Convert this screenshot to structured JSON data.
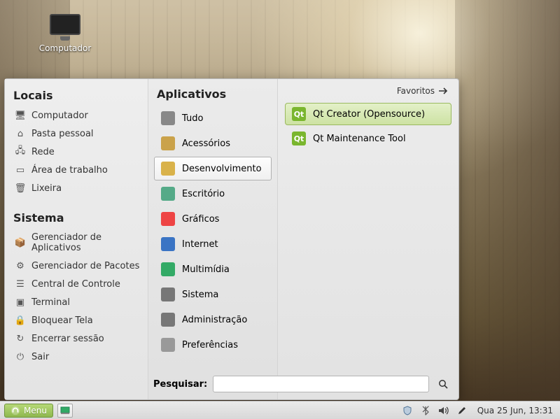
{
  "desktop": {
    "icon_label": "Computador"
  },
  "menu": {
    "places_heading": "Locais",
    "places": [
      {
        "label": "Computador",
        "icon": "monitor-icon"
      },
      {
        "label": "Pasta pessoal",
        "icon": "home-icon"
      },
      {
        "label": "Rede",
        "icon": "network-icon"
      },
      {
        "label": "Área de trabalho",
        "icon": "desktop-icon"
      },
      {
        "label": "Lixeira",
        "icon": "trash-icon"
      }
    ],
    "system_heading": "Sistema",
    "system": [
      {
        "label": "Gerenciador de Aplicativos",
        "icon": "apps-mgr-icon"
      },
      {
        "label": "Gerenciador de Pacotes",
        "icon": "pkg-mgr-icon"
      },
      {
        "label": "Central de Controle",
        "icon": "control-center-icon"
      },
      {
        "label": "Terminal",
        "icon": "terminal-icon"
      },
      {
        "label": "Bloquear Tela",
        "icon": "lock-icon"
      },
      {
        "label": "Encerrar sessão",
        "icon": "logout-icon"
      },
      {
        "label": "Sair",
        "icon": "power-icon"
      }
    ],
    "apps_heading": "Aplicativos",
    "favorites_label": "Favoritos",
    "categories": [
      {
        "label": "Tudo",
        "icon": "all-icon",
        "color": "#888"
      },
      {
        "label": "Acessórios",
        "icon": "accessories-icon",
        "color": "#caa24a"
      },
      {
        "label": "Desenvolvimento",
        "icon": "development-icon",
        "color": "#d9b24a",
        "selected": true
      },
      {
        "label": "Escritório",
        "icon": "office-icon",
        "color": "#5a8"
      },
      {
        "label": "Gráficos",
        "icon": "graphics-icon",
        "color": "#e44"
      },
      {
        "label": "Internet",
        "icon": "internet-icon",
        "color": "#3a74c4"
      },
      {
        "label": "Multimídia",
        "icon": "multimedia-icon",
        "color": "#3a6"
      },
      {
        "label": "Sistema",
        "icon": "system-icon",
        "color": "#777"
      },
      {
        "label": "Administração",
        "icon": "admin-icon",
        "color": "#777"
      },
      {
        "label": "Preferências",
        "icon": "prefs-icon",
        "color": "#999"
      }
    ],
    "apps": [
      {
        "label": "Qt Creator (Opensource)",
        "icon": "qt-icon",
        "color": "#7ab62e",
        "highlight": true
      },
      {
        "label": "Qt Maintenance Tool",
        "icon": "qt-icon",
        "color": "#7ab62e",
        "highlight": false
      }
    ],
    "search_label": "Pesquisar:",
    "search_placeholder": ""
  },
  "taskbar": {
    "menu_label": "Menu",
    "clock": "Qua 25 Jun, 13:31"
  }
}
